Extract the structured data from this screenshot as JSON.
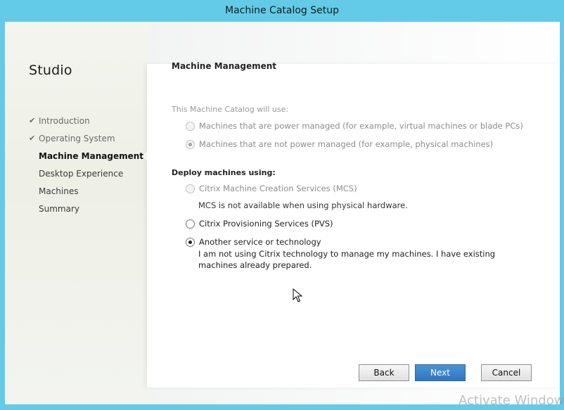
{
  "window": {
    "title": "Machine Catalog Setup"
  },
  "sidebar": {
    "title": "Studio",
    "steps": [
      {
        "label": "Introduction",
        "state": "done"
      },
      {
        "label": "Operating System",
        "state": "done"
      },
      {
        "label": "Machine Management",
        "state": "active"
      },
      {
        "label": "Desktop Experience",
        "state": "pending"
      },
      {
        "label": "Machines",
        "state": "pending"
      },
      {
        "label": "Summary",
        "state": "pending"
      }
    ]
  },
  "main": {
    "title": "Machine Management",
    "catalog_section": {
      "label": "This Machine Catalog will use:",
      "options": [
        {
          "label": "Machines that are power managed (for example, virtual machines or blade PCs)",
          "selected": false,
          "enabled": false
        },
        {
          "label": "Machines that are not power managed (for example, physical machines)",
          "selected": true,
          "enabled": false
        }
      ]
    },
    "deploy_section": {
      "label": "Deploy machines using:",
      "options": [
        {
          "label": "Citrix Machine Creation Services (MCS)",
          "selected": false,
          "enabled": false,
          "note": "MCS is not available when using physical hardware."
        },
        {
          "label": "Citrix Provisioning Services (PVS)",
          "selected": false,
          "enabled": true
        },
        {
          "label": "Another service or technology",
          "selected": true,
          "enabled": true,
          "description": "I am not using Citrix technology to manage my machines. I have existing machines already prepared."
        }
      ]
    }
  },
  "footer": {
    "back_label": "Back",
    "next_label": "Next",
    "cancel_label": "Cancel"
  },
  "watermark": "Activate Window",
  "colors": {
    "frame": "#63cbe8",
    "primary_button": "#3480c8"
  }
}
